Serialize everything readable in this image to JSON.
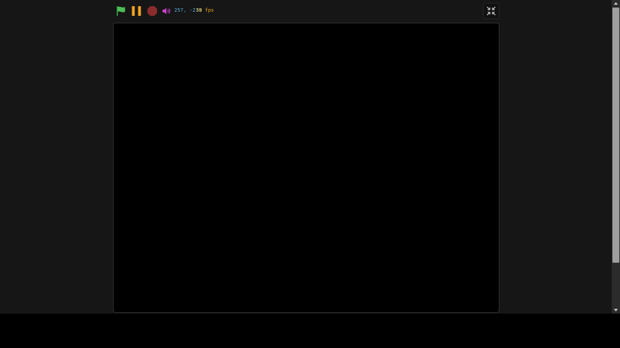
{
  "toolbar": {
    "coords_text": "257, -239",
    "fps_text": "50 fps",
    "icons": {
      "flag": "green-flag-icon",
      "pause": "pause-icon",
      "stop": "stop-icon",
      "sound": "speaker-icon",
      "fullscreen": "exit-fullscreen-icon"
    }
  },
  "colors": {
    "background": "#161616",
    "stage": "#000000",
    "flag": "#4cbf56",
    "pause": "#f5a623",
    "stop": "#8b2c2c",
    "sound": "#cc44cc",
    "coords": "#5fb3e6",
    "fps": "#f5b21b",
    "scrollbar_track": "#2b2b2b",
    "scrollbar_thumb": "#9e9e9e"
  }
}
